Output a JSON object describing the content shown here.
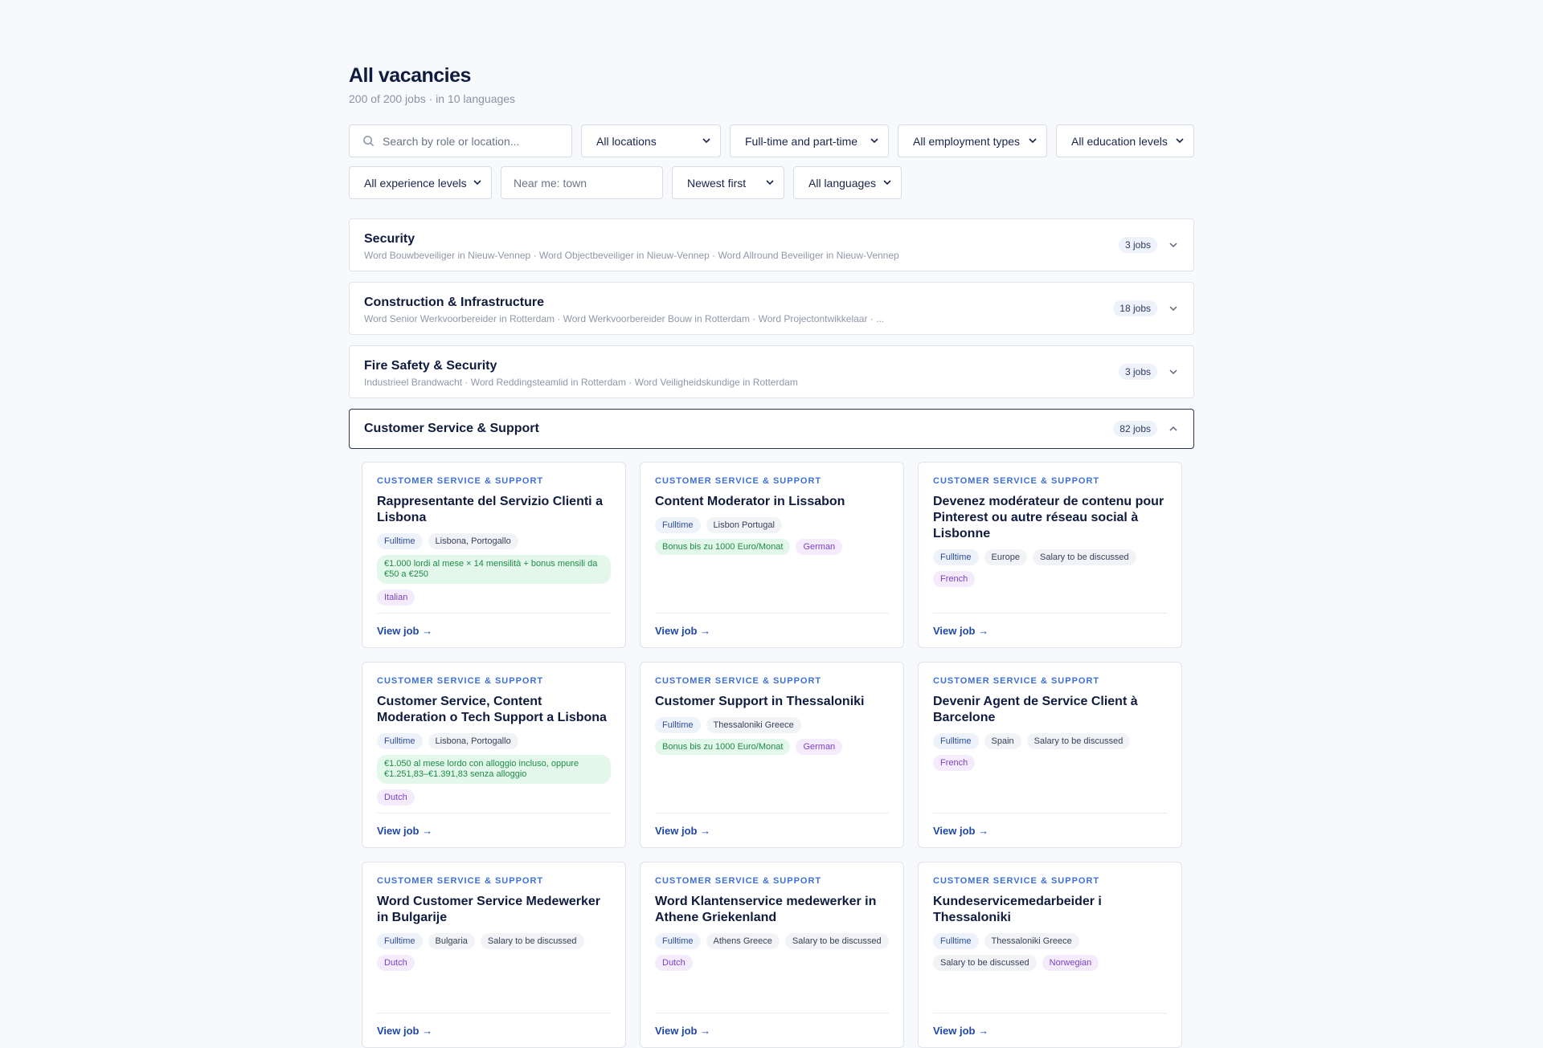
{
  "header": {
    "title": "All vacancies",
    "subtitle": "200 of 200 jobs · in 10 languages"
  },
  "filters": {
    "search_placeholder": "Search by role or location...",
    "locations": "All locations",
    "hours": "Full-time and part-time",
    "employment": "All employment types",
    "education": "All education levels",
    "experience": "All experience levels",
    "near_placeholder": "Near me: town",
    "sort": "Newest first",
    "languages": "All languages"
  },
  "sections": [
    {
      "title": "Security",
      "desc": "Word Bouwbeveiliger in Nieuw-Vennep · Word Objectbeveiliger in Nieuw-Vennep · Word Allround Beveiliger in Nieuw-Vennep",
      "count": "3 jobs"
    },
    {
      "title": "Construction & Infrastructure",
      "desc": "Word Senior Werkvoorbereider in Rotterdam · Word Werkvoorbereider Bouw in Rotterdam · Word Projectontwikkelaar · ...",
      "count": "18 jobs"
    },
    {
      "title": "Fire Safety & Security",
      "desc": "Industrieel Brandwacht · Word Reddingsteamlid in Rotterdam · Word Veiligheidskundige in Rotterdam",
      "count": "3 jobs"
    },
    {
      "title": "Customer Service & Support",
      "count": "82 jobs"
    }
  ],
  "cards": [
    {
      "category": "CUSTOMER SERVICE & SUPPORT",
      "title": "Rappresentante del Servizio Clienti a Lisbona",
      "type": "Fulltime",
      "location": "Lisbona, Portogallo",
      "salary": "€1.000 lordi al mese × 14 mensilità + bonus mensili da €50 a €250",
      "language": "Italian",
      "link": "View job →"
    },
    {
      "category": "CUSTOMER SERVICE & SUPPORT",
      "title": "Content Moderator in Lissabon",
      "type": "Fulltime",
      "location": "Lisbon Portugal",
      "salary": "Bonus bis zu 1000 Euro/Monat",
      "language": "German",
      "link": "View job →"
    },
    {
      "category": "CUSTOMER SERVICE & SUPPORT",
      "title": "Devenez modérateur de contenu pour Pinterest ou autre réseau social à Lisbonne",
      "type": "Fulltime",
      "location": "Europe",
      "salary": "Salary to be discussed",
      "language": "French",
      "link": "View job →"
    },
    {
      "category": "CUSTOMER SERVICE & SUPPORT",
      "title": "Customer Service, Content Moderation o Tech Support a Lisbona",
      "type": "Fulltime",
      "location": "Lisbona, Portogallo",
      "salary": "€1.050 al mese lordo con alloggio incluso, oppure €1.251,83–€1.391,83 senza alloggio",
      "language": "Dutch",
      "link": "View job →"
    },
    {
      "category": "CUSTOMER SERVICE & SUPPORT",
      "title": "Customer Support in Thessaloniki",
      "type": "Fulltime",
      "location": "Thessaloniki Greece",
      "salary": "Bonus bis zu 1000 Euro/Monat",
      "language": "German",
      "link": "View job →"
    },
    {
      "category": "CUSTOMER SERVICE & SUPPORT",
      "title": "Devenir Agent de Service Client à Barcelone",
      "type": "Fulltime",
      "location": "Spain",
      "salary": "Salary to be discussed",
      "language": "French",
      "link": "View job →"
    },
    {
      "category": "CUSTOMER SERVICE & SUPPORT",
      "title": "Word Customer Service Medewerker in Bulgarije",
      "type": "Fulltime",
      "location": "Bulgaria",
      "salary": "Salary to be discussed",
      "language": "Dutch",
      "link": "View job →"
    },
    {
      "category": "CUSTOMER SERVICE & SUPPORT",
      "title": "Word Klantenservice medewerker in Athene Griekenland",
      "type": "Fulltime",
      "location": "Athens Greece",
      "salary": "Salary to be discussed",
      "language": "Dutch",
      "link": "View job →"
    },
    {
      "category": "CUSTOMER SERVICE & SUPPORT",
      "title": "Kundeservicemedarbeider i Thessaloniki",
      "type": "Fulltime",
      "location": "Thessaloniki Greece",
      "salary": "Salary to be discussed",
      "language": "Norwegian",
      "link": "View job →"
    }
  ]
}
